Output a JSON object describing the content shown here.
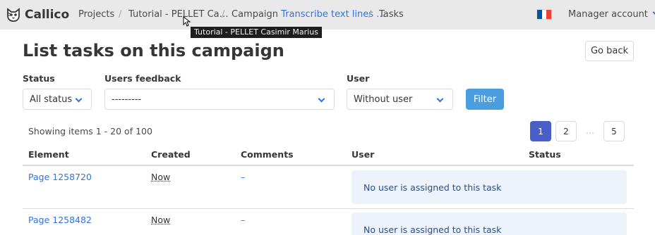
{
  "brand": {
    "name": "Callico"
  },
  "breadcrumb": {
    "projects": "Projects",
    "project": "Tutorial - PELLET Ca…",
    "campaign_prefix": "Campaign",
    "campaign_link": "Transcribe text lines …",
    "tasks": "Tasks"
  },
  "tooltip": {
    "text": "Tutorial - PELLET Casimir Marius"
  },
  "language": {
    "flag_colors": [
      "#0055A4",
      "#FFFFFF",
      "#EF4135"
    ]
  },
  "account": {
    "label": "Manager account"
  },
  "page": {
    "title": "List tasks on this campaign",
    "go_back": "Go back"
  },
  "filters": {
    "status_label": "Status",
    "status_value": "All status",
    "feedback_label": "Users feedback",
    "feedback_value": "---------",
    "user_label": "User",
    "user_value": "Without user",
    "filter_button": "Filter"
  },
  "summary": "Showing items 1 - 20 of 100",
  "pagination": {
    "pages": [
      "1",
      "2",
      "5"
    ],
    "ellipsis": "…",
    "current": "1"
  },
  "table": {
    "headers": [
      "Element",
      "Created",
      "Comments",
      "User",
      "Status"
    ],
    "rows": [
      {
        "element": "Page 1258720",
        "created": "Now",
        "comments": "–",
        "user": "No user is assigned to this task",
        "status": ""
      },
      {
        "element": "Page 1258482",
        "created": "Now",
        "comments": "–",
        "user": "No user is assigned to this task",
        "status": ""
      }
    ]
  },
  "colors": {
    "accent": "#3273dc",
    "primary_button": "#4a9ee0",
    "current_page": "#485fc7",
    "navbar": "#e9e9e9",
    "notice_bg": "#eef3fb"
  }
}
